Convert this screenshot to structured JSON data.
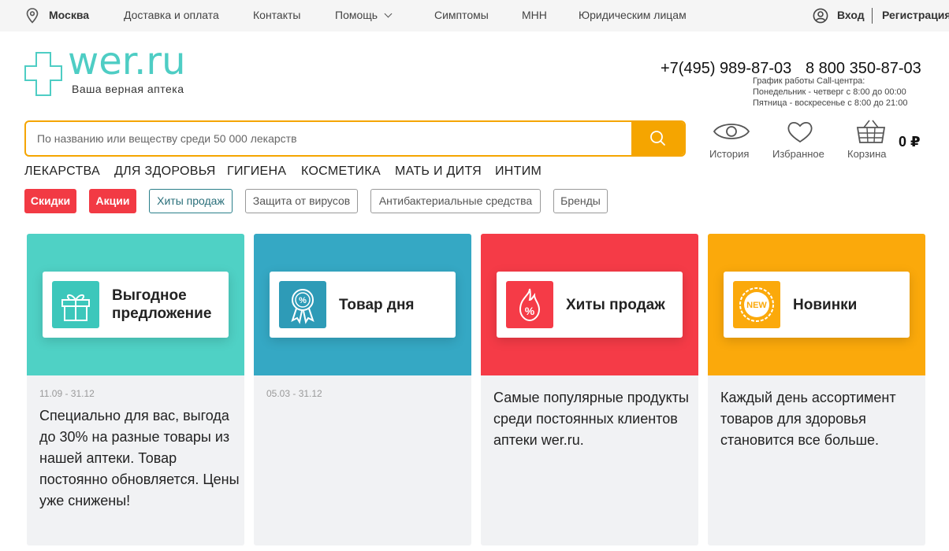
{
  "topbar": {
    "city": "Москва",
    "links": [
      "Доставка и оплата",
      "Контакты",
      "Помощь",
      "Симптомы",
      "МНН",
      "Юридическим лицам"
    ],
    "login": "Вход",
    "register": "Регистрация"
  },
  "logo": {
    "name": "wer.ru",
    "tagline": "Ваша верная аптека",
    "color": "#4ecdc4"
  },
  "contacts": {
    "phone1": "+7(495) 989-87-03",
    "phone2": "8 800 350-87-03",
    "schedule_title": "График работы Call-центра:",
    "schedule_line1": "Понедельник - четверг с 8:00 до 00:00",
    "schedule_line2": "Пятница - воскресенье с 8:00 до 21:00"
  },
  "search": {
    "placeholder": "По названию или веществу среди 50 000 лекарств",
    "value": ""
  },
  "header_icons": {
    "history": "История",
    "favorites": "Избранное",
    "cart": "Корзина",
    "cart_total": "0 ₽"
  },
  "categories": [
    "ЛЕКАРСТВА",
    "ДЛЯ ЗДОРОВЬЯ",
    "ГИГИЕНА",
    "КОСМЕТИКА",
    "МАТЬ И ДИТЯ",
    "ИНТИМ"
  ],
  "chips": [
    "Скидки",
    "Акции",
    "Хиты продаж",
    "Защита от вирусов",
    "Антибактериальные средства",
    "Бренды"
  ],
  "cards": [
    {
      "title": "Выгодное предложение",
      "date": "11.09 - 31.12",
      "desc": "Специально для вас, выгода до 30% на разные товары из нашей аптеки. Товар постоянно обновляется. Цены уже снижены!",
      "color": "#4fd1c5",
      "badge_color": "#3cc7bb",
      "icon": "gift-icon"
    },
    {
      "title": "Товар дня",
      "date": "05.03 - 31.12",
      "desc": "",
      "color": "#35a8c4",
      "badge_color": "#2e9bb7",
      "icon": "percent-ribbon-icon"
    },
    {
      "title": "Хиты продаж",
      "date": "",
      "desc": "Самые популярные продукты среди постоянных клиентов аптеки wer.ru.",
      "color": "#f53b47",
      "badge_color": "#f53b47",
      "icon": "fire-percent-icon"
    },
    {
      "title": "Новинки",
      "date": "",
      "desc": "Каждый день ассортимент товаров для здоровья становится все больше.",
      "color": "#fba90b",
      "badge_color": "#fba90b",
      "icon": "new-badge-icon"
    }
  ]
}
